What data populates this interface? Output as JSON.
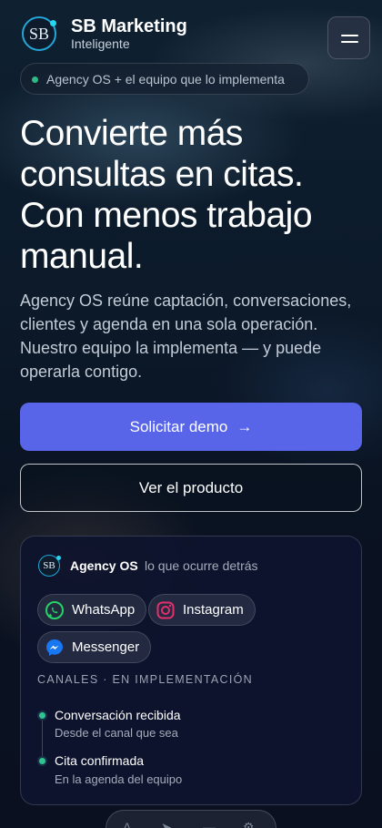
{
  "header": {
    "logo_text": "SB",
    "brand_name": "SB Marketing",
    "brand_sub": "Inteligente"
  },
  "pill": {
    "text": "Agency OS + el equipo que lo implementa"
  },
  "hero": {
    "title": "Convierte más consultas en citas. Con menos trabajo manual.",
    "description": "Agency OS reúne captación, conversaciones, clientes y agenda en una sola operación. Nuestro equipo la implementa — y puede operarla contigo."
  },
  "buttons": {
    "primary": "Solicitar demo",
    "primary_arrow": "→",
    "secondary": "Ver el producto"
  },
  "card": {
    "logo_text": "SB",
    "title": "Agency OS",
    "subtitle": "lo que ocurre detrás",
    "chips": [
      {
        "label": "WhatsApp",
        "icon": "whatsapp-icon",
        "color": "#25d366"
      },
      {
        "label": "Instagram",
        "icon": "instagram-icon",
        "color": "#e1306c"
      },
      {
        "label": "Messenger",
        "icon": "messenger-icon",
        "color": "#1877f2"
      }
    ],
    "section_label": "CANALES · EN IMPLEMENTACIÓN",
    "timeline": [
      {
        "title": "Conversación recibida",
        "sub": "Desde el canal que sea"
      },
      {
        "title": "Cita confirmada",
        "sub": "En la agenda del equipo"
      }
    ]
  },
  "colors": {
    "accent": "#5865e8",
    "status_green": "#2fc48d",
    "logo_ring": "#22a7d6"
  }
}
